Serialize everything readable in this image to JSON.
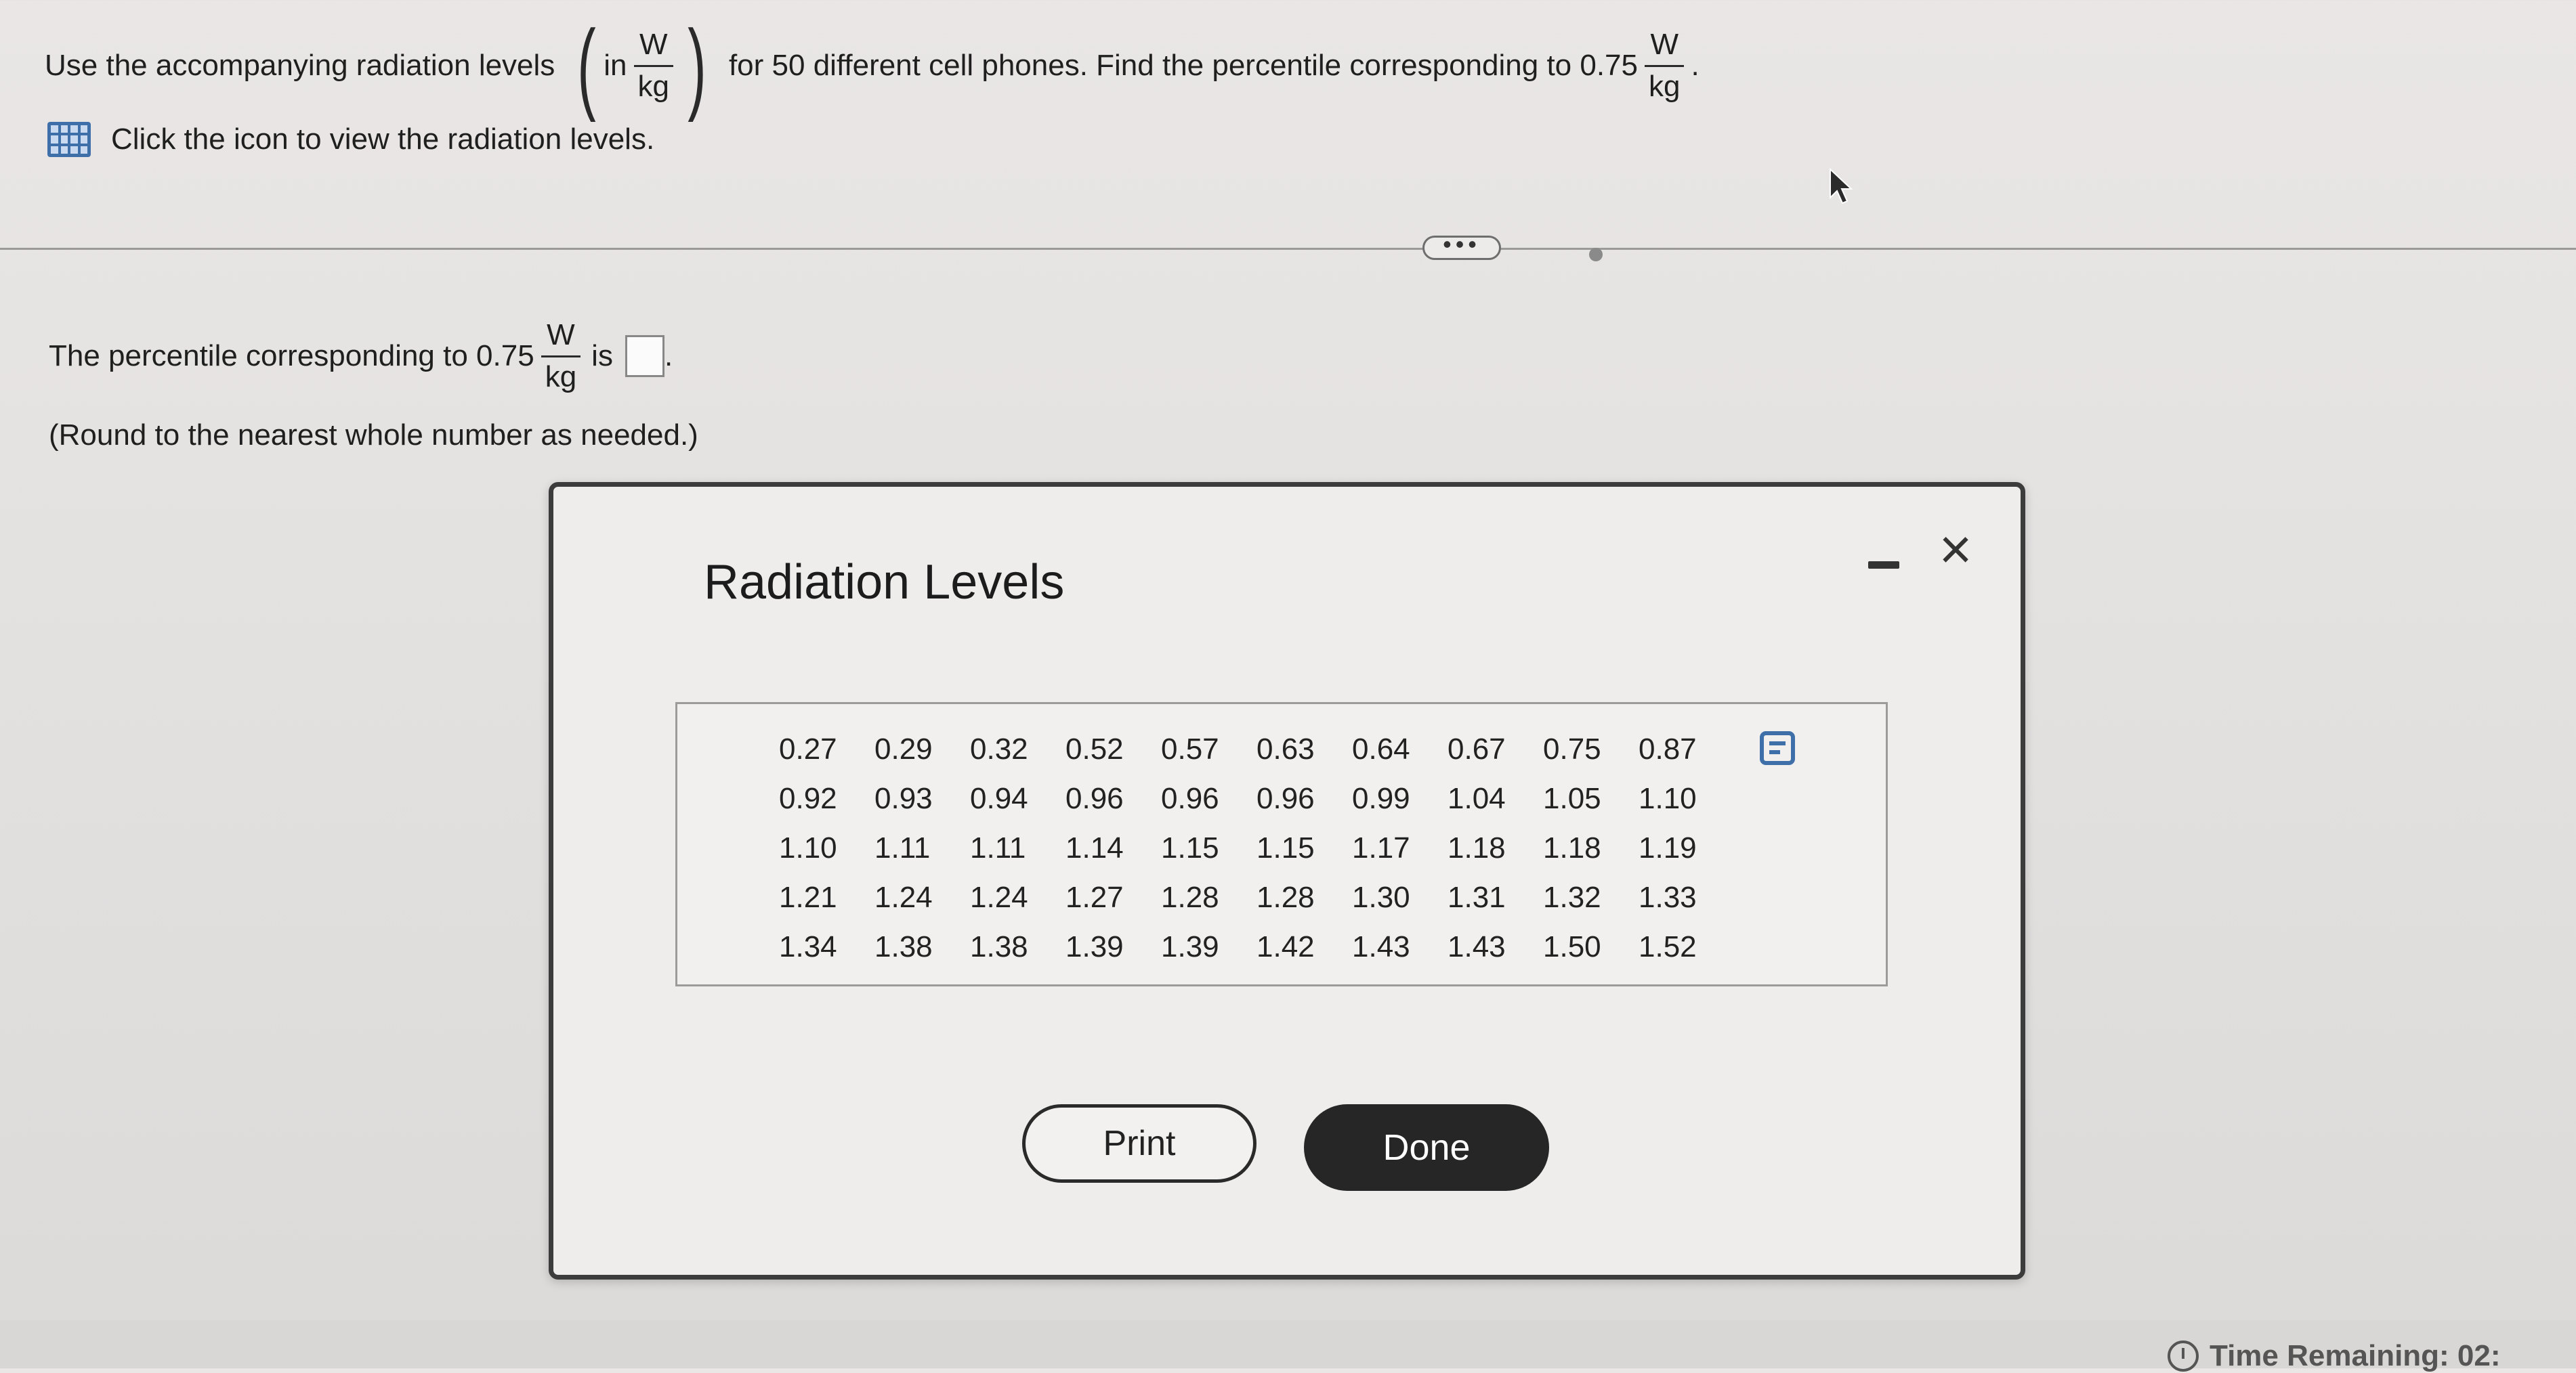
{
  "question": {
    "prefix": "Use the accompanying radiation levels",
    "paren_open": "(",
    "in_word": "in",
    "unit_num": "W",
    "unit_den": "kg",
    "paren_close": ")",
    "middle": "for 50 different cell phones. Find the percentile corresponding to 0.75",
    "end": "."
  },
  "view_link": {
    "label": "Click the icon to view the radiation levels.",
    "icon": "table-grid-icon"
  },
  "divider": {
    "expander_label": "•••"
  },
  "answer": {
    "prefix": "The percentile corresponding to 0.75",
    "unit_num": "W",
    "unit_den": "kg",
    "is_word": "is",
    "end": ".",
    "note": "(Round to the nearest whole number as needed.)"
  },
  "dialog": {
    "title": "Radiation Levels",
    "minimize_icon": "minimize-icon",
    "close_label": "×",
    "copy_icon": "copy-icon",
    "rows": [
      [
        "0.27",
        "0.29",
        "0.32",
        "0.52",
        "0.57",
        "0.63",
        "0.64",
        "0.67",
        "0.75",
        "0.87"
      ],
      [
        "0.92",
        "0.93",
        "0.94",
        "0.96",
        "0.96",
        "0.96",
        "0.99",
        "1.04",
        "1.05",
        "1.10"
      ],
      [
        "1.10",
        "1.11",
        "1.11",
        "1.14",
        "1.15",
        "1.15",
        "1.17",
        "1.18",
        "1.18",
        "1.19"
      ],
      [
        "1.21",
        "1.24",
        "1.24",
        "1.27",
        "1.28",
        "1.28",
        "1.30",
        "1.31",
        "1.32",
        "1.33"
      ],
      [
        "1.34",
        "1.38",
        "1.38",
        "1.39",
        "1.39",
        "1.42",
        "1.43",
        "1.43",
        "1.50",
        "1.52"
      ]
    ],
    "print_label": "Print",
    "done_label": "Done"
  },
  "footer": {
    "time_remaining": "Time Remaining: 02:"
  },
  "colors": {
    "accent": "#3f6fa8",
    "done_button": "#262626",
    "background": "#e6e4e3"
  }
}
